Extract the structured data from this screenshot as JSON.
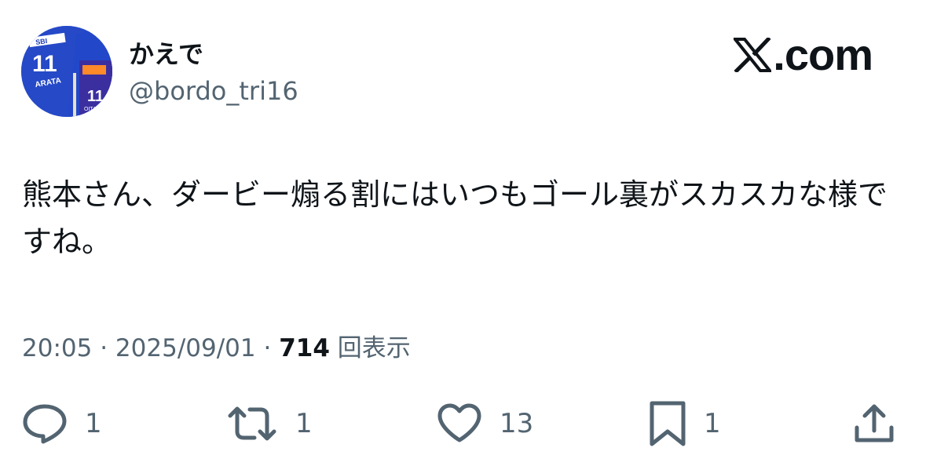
{
  "author": {
    "display_name": "かえで",
    "handle": "@bordo_tri16"
  },
  "brand": {
    "label": ".com"
  },
  "tweet": {
    "text": "熊本さん、ダービー煽る割にはいつもゴール裏がスカスカな様ですね。"
  },
  "meta": {
    "time": "20:05",
    "separator": "·",
    "date": "2025/09/01",
    "views_count": "714",
    "views_label": "回表示"
  },
  "actions": {
    "reply_count": "1",
    "retweet_count": "1",
    "like_count": "13",
    "bookmark_count": "1"
  },
  "avatar_badge": {
    "sponsor": "SBI",
    "number": "11",
    "name": "ARATA",
    "team": "OITA"
  },
  "icons": [
    "x-logo-icon",
    "reply-icon",
    "retweet-icon",
    "like-icon",
    "bookmark-icon",
    "share-icon"
  ],
  "colors": {
    "text_primary": "#0f1419",
    "text_secondary": "#536471",
    "avatar_blue": "#1f3fb5"
  }
}
